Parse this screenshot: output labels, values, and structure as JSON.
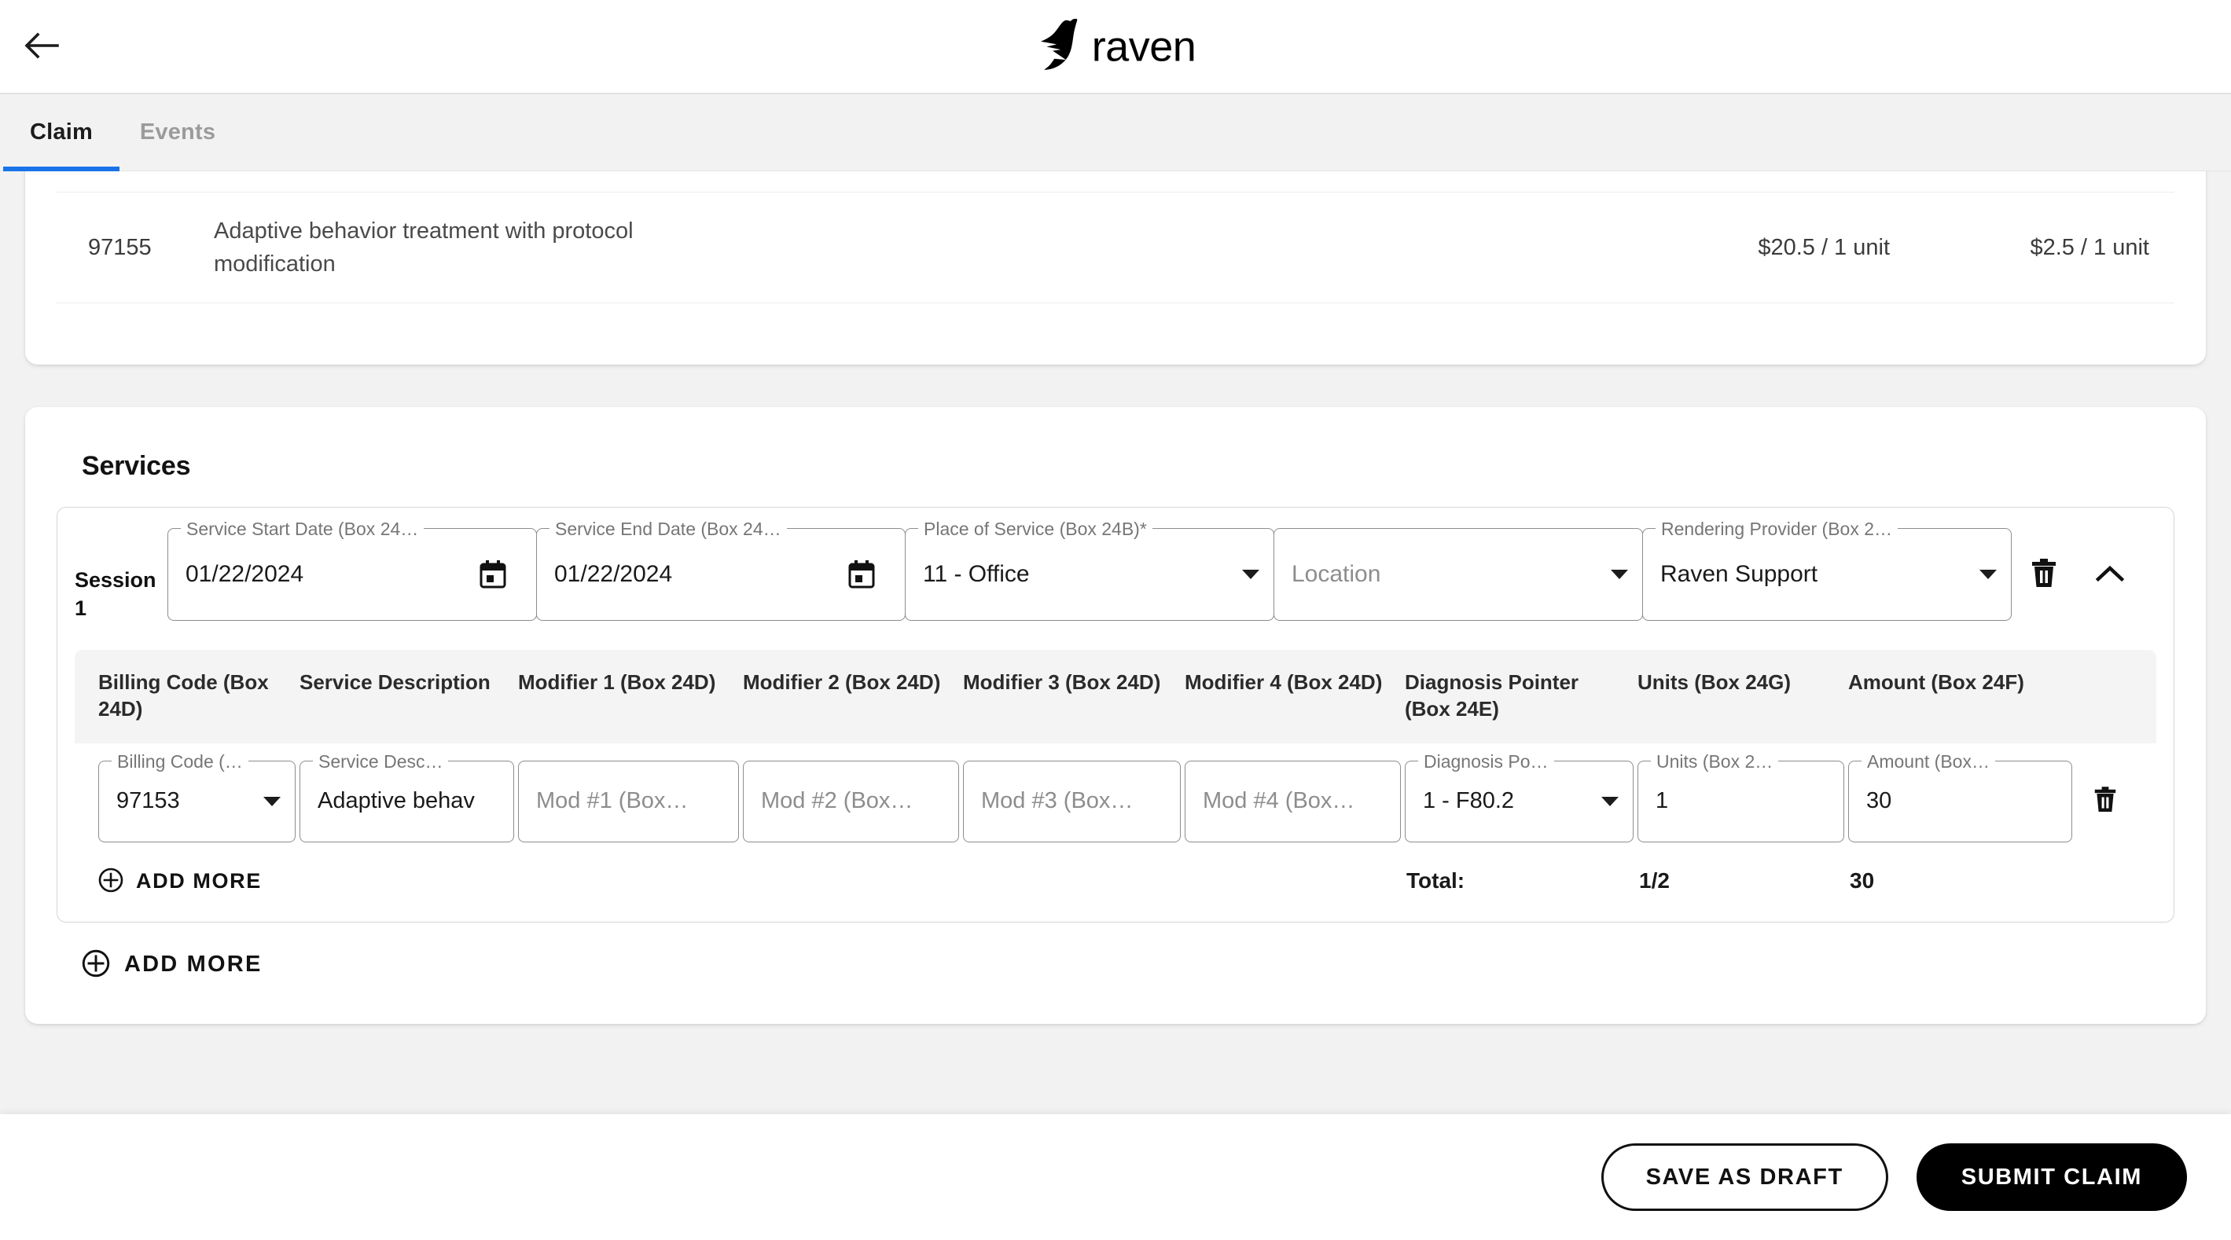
{
  "header": {
    "back_icon": "arrow-left-icon",
    "brand_name": "raven",
    "brand_mark": "raven-bird-logo"
  },
  "tabs": [
    {
      "label": "Claim",
      "active": true
    },
    {
      "label": "Events",
      "active": false
    }
  ],
  "claim_lines": {
    "rows": [
      {
        "code": "97155",
        "description": "Adaptive behavior treatment with protocol modification",
        "rate_primary": "$20.5 / 1 unit",
        "rate_secondary": "$2.5 / 1 unit"
      }
    ]
  },
  "services": {
    "title": "Services",
    "session": {
      "label": "Session 1",
      "delete_icon": "trash-icon",
      "collapse_icon": "chevron-up-icon",
      "fields": [
        {
          "legend": "Service Start Date (Box 24…",
          "value": "01/22/2024",
          "control": "calendar-icon"
        },
        {
          "legend": "Service End Date (Box 24…",
          "value": "01/22/2024",
          "control": "calendar-icon"
        },
        {
          "legend": "Place of Service (Box 24B)*",
          "value": "11 - Office",
          "control": "dropdown"
        },
        {
          "legend": "",
          "value": "Location",
          "placeholder": true,
          "control": "dropdown"
        },
        {
          "legend": "Rendering Provider (Box 2…",
          "value": "Raven Support",
          "control": "dropdown"
        }
      ]
    },
    "table": {
      "columns": [
        "Billing Code (Box 24D)",
        "Service Description",
        "Modifier 1 (Box 24D)",
        "Modifier 2 (Box 24D)",
        "Modifier 3 (Box 24D)",
        "Modifier 4 (Box 24D)",
        "Diagnosis Pointer (Box 24E)",
        "Units (Box 24G)",
        "Amount (Box 24F)"
      ],
      "rows": [
        {
          "billing_code": {
            "legend": "Billing Code (…",
            "value": "97153",
            "control": "dropdown"
          },
          "service_description": {
            "legend": "Service Desc…",
            "value": "Adaptive behav"
          },
          "modifier_1": {
            "legend": "",
            "value": "Mod #1 (Box…",
            "placeholder": true
          },
          "modifier_2": {
            "legend": "",
            "value": "Mod #2 (Box…",
            "placeholder": true
          },
          "modifier_3": {
            "legend": "",
            "value": "Mod #3 (Box…",
            "placeholder": true
          },
          "modifier_4": {
            "legend": "",
            "value": "Mod #4 (Box…",
            "placeholder": true
          },
          "diagnosis_pointer": {
            "legend": "Diagnosis Po…",
            "value": "1 - F80.2",
            "control": "dropdown"
          },
          "units": {
            "legend": "Units (Box 2…",
            "value": "1"
          },
          "amount": {
            "legend": "Amount (Box…",
            "value": "30"
          },
          "delete_icon": "trash-icon"
        }
      ],
      "add_more_label": "ADD MORE",
      "add_more_icon": "plus-circle-icon",
      "totals": {
        "label": "Total:",
        "units": "1/2",
        "amount": "30"
      }
    },
    "add_more_label": "ADD MORE",
    "add_more_icon": "plus-circle-icon"
  },
  "footer": {
    "save_draft_label": "SAVE AS DRAFT",
    "submit_label": "SUBMIT CLAIM"
  },
  "colors": {
    "accent_tab": "#1a73e8",
    "page_bg": "#f2f2f2",
    "card_bg": "#ffffff",
    "primary_button": "#000000"
  }
}
